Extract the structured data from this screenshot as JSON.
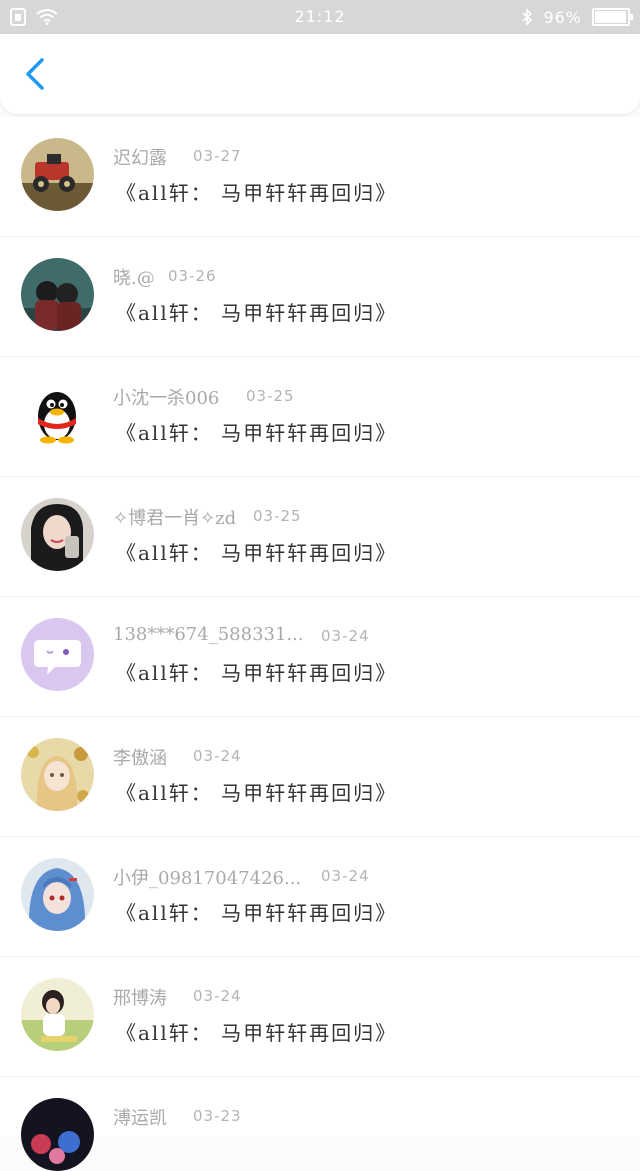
{
  "status_bar": {
    "time": "21:12",
    "battery": "96%",
    "battery_level": 0.96
  },
  "header": {
    "back_icon": "chevron-left-icon",
    "accent": "#1e9bf0"
  },
  "messages": [
    {
      "name": "迟幻露",
      "date": "03-27",
      "text": "《all轩： 马甲轩轩再回归》",
      "avatar": "vintage-car-photo"
    },
    {
      "name": "晓.@",
      "date": "03-26",
      "text": "《all轩： 马甲轩轩再回归》",
      "avatar": "two-people-photo"
    },
    {
      "name": "小沈一杀006",
      "date": "03-25",
      "text": "《all轩： 马甲轩轩再回归》",
      "avatar": "qq-penguin-icon"
    },
    {
      "name": "✧博君一肖✧zd",
      "date": "03-25",
      "text": "《all轩： 马甲轩轩再回归》",
      "avatar": "girl-photo"
    },
    {
      "name": "138***674_588331...",
      "date": "03-24",
      "text": "《all轩： 马甲轩轩再回归》",
      "avatar": "chat-bubble-icon"
    },
    {
      "name": "李傲涵",
      "date": "03-24",
      "text": "《all轩： 马甲轩轩再回归》",
      "avatar": "anime-girl-floral"
    },
    {
      "name": "小伊_09817047426...",
      "date": "03-24",
      "text": "《all轩： 马甲轩轩再回归》",
      "avatar": "anime-blue-hair"
    },
    {
      "name": "邢博涛",
      "date": "03-24",
      "text": "《all轩： 马甲轩轩再回归》",
      "avatar": "girl-sunset-photo"
    },
    {
      "name": "溥运凯",
      "date": "03-23",
      "text": "",
      "avatar": "anime-group-photo"
    }
  ]
}
